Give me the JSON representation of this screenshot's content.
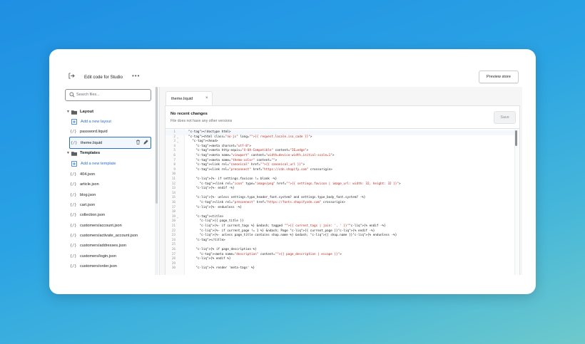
{
  "topbar": {
    "title": "Edit code for Studio",
    "more_label": "•••",
    "preview_label": "Preview store"
  },
  "sidebar": {
    "search_placeholder": "Search files...",
    "layout_folder": "Layout",
    "add_layout": "Add a new layout",
    "layout_files": [
      "password.liquid",
      "theme.liquid"
    ],
    "templates_folder": "Templates",
    "add_template": "Add a new template",
    "template_files": [
      "404.json",
      "article.json",
      "blog.json",
      "cart.json",
      "collection.json",
      "customers/account.json",
      "customers/activate_account.json",
      "customers/addresses.json",
      "customers/login.json",
      "customers/order.json"
    ],
    "file_icon": "{/}"
  },
  "editor": {
    "tab_label": "theme.liquid",
    "tab_close": "×",
    "banner_title": "No recent changes",
    "banner_sub": "File does not have any other versions",
    "save_label": "Save",
    "lines": [
      "<!doctype html>",
      "<html class=\"no-js\" lang=\"{{ request.locale.iso_code }}\">",
      "  <head>",
      "    <meta charset=\"utf-8\">",
      "    <meta http-equiv=\"X-UA-Compatible\" content=\"IE=edge\">",
      "    <meta name=\"viewport\" content=\"width=device-width,initial-scale=1\">",
      "    <meta name=\"theme-color\" content=\"\">",
      "    <link rel=\"canonical\" href=\"{{ canonical_url }}\">",
      "    <link rel=\"preconnect\" href=\"https://cdn.shopify.com\" crossorigin>",
      "",
      "    {%- if settings.favicon != blank -%}",
      "      <link rel=\"icon\" type=\"image/png\" href=\"{{ settings.favicon | image_url: width: 32, height: 32 }}\">",
      "    {%- endif -%}",
      "",
      "    {%- unless settings.type_header_font.system? and settings.type_body_font.system? -%}",
      "      <link rel=\"preconnect\" href=\"https://fonts.shopifycdn.com\" crossorigin>",
      "    {%- endunless -%}",
      "",
      "    <title>",
      "      {{ page_title }}",
      "      {%- if current_tags %} &ndash; tagged \"{{ current_tags | join: ', ' }}\"{% endif -%}",
      "      {%- if current_page != 1 %} &ndash; Page {{ current_page }}{% endif -%}",
      "      {%- unless page_title contains shop.name %} &ndash; {{ shop.name }}{% endunless -%}",
      "    </title>",
      "",
      "    {% if page_description %}",
      "      <meta name=\"description\" content=\"{{ page_description | escape }}\">",
      "    {% endif %}",
      "",
      "    {% render 'meta-tags' %}"
    ]
  }
}
